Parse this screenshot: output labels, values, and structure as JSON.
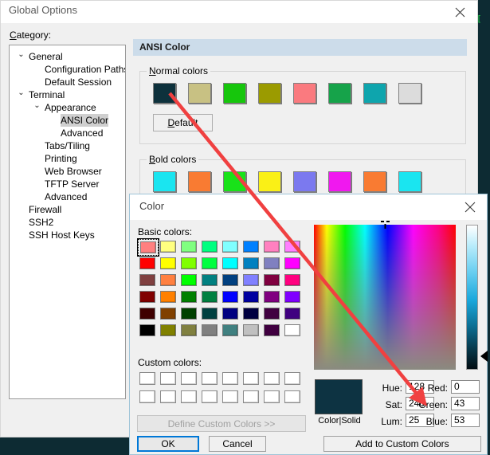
{
  "window": {
    "title": "Global Options",
    "close_icon": "close-icon",
    "category_label": "Category:"
  },
  "terminal": {
    "prompt": "["
  },
  "tree": {
    "items": [
      {
        "label": "General",
        "indent": 0,
        "chevron": "chevron-down-icon",
        "selected": false
      },
      {
        "label": "Configuration Paths",
        "indent": 1,
        "chevron": "",
        "selected": false
      },
      {
        "label": "Default Session",
        "indent": 1,
        "chevron": "",
        "selected": false
      },
      {
        "label": "Terminal",
        "indent": 0,
        "chevron": "chevron-down-icon",
        "selected": false
      },
      {
        "label": "Appearance",
        "indent": 1,
        "chevron": "chevron-down-icon",
        "selected": false
      },
      {
        "label": "ANSI Color",
        "indent": 2,
        "chevron": "",
        "selected": true
      },
      {
        "label": "Advanced",
        "indent": 2,
        "chevron": "",
        "selected": false
      },
      {
        "label": "Tabs/Tiling",
        "indent": 1,
        "chevron": "",
        "selected": false
      },
      {
        "label": "Printing",
        "indent": 1,
        "chevron": "",
        "selected": false
      },
      {
        "label": "Web Browser",
        "indent": 1,
        "chevron": "",
        "selected": false
      },
      {
        "label": "TFTP Server",
        "indent": 1,
        "chevron": "",
        "selected": false
      },
      {
        "label": "Advanced",
        "indent": 1,
        "chevron": "",
        "selected": false
      },
      {
        "label": "Firewall",
        "indent": 0,
        "chevron": "",
        "selected": false
      },
      {
        "label": "SSH2",
        "indent": 0,
        "chevron": "",
        "selected": false
      },
      {
        "label": "SSH Host Keys",
        "indent": 0,
        "chevron": "",
        "selected": false
      }
    ]
  },
  "pane": {
    "header": "ANSI Color",
    "normal_group_title": "Normal colors",
    "bold_group_title": "Bold colors",
    "default_button": "Default",
    "normal_colors": [
      "#0d313c",
      "#c8c183",
      "#16c60c",
      "#9b9b00",
      "#fa7a7f",
      "#16a34a",
      "#0ea5ad",
      "#dcdcdc"
    ],
    "bold_colors": [
      "#1ae5f0",
      "#f97b32",
      "#19e219",
      "#faf016",
      "#7b79ef",
      "#f018ef",
      "#f97b32",
      "#1ae5f0"
    ]
  },
  "color_dialog": {
    "title": "Color",
    "close_icon": "close-icon",
    "basic_label": "Basic colors:",
    "custom_label": "Custom colors:",
    "define_button": "Define Custom Colors >>",
    "ok_button": "OK",
    "cancel_button": "Cancel",
    "add_custom_button": "Add to Custom Colors",
    "preview_label": "Color|Solid",
    "preview_color": "#0d3342",
    "selected_basic_index": 0,
    "basic_colors": [
      "#ff8080",
      "#ffff80",
      "#80ff80",
      "#00ff80",
      "#80ffff",
      "#0080ff",
      "#ff80c0",
      "#ff80ff",
      "#ff0000",
      "#ffff00",
      "#80ff00",
      "#00ff40",
      "#00ffff",
      "#0080c0",
      "#8080c0",
      "#ff00ff",
      "#804040",
      "#ff8040",
      "#00ff00",
      "#008080",
      "#004080",
      "#8080ff",
      "#800040",
      "#ff0080",
      "#800000",
      "#ff8000",
      "#008000",
      "#008040",
      "#0000ff",
      "#0000a0",
      "#800080",
      "#8000ff",
      "#400000",
      "#804000",
      "#004000",
      "#004040",
      "#000080",
      "#000040",
      "#400040",
      "#400080",
      "#000000",
      "#808000",
      "#808040",
      "#808080",
      "#408080",
      "#c0c0c0",
      "#400040",
      "#ffffff"
    ],
    "custom_colors_count": 16,
    "fields": [
      {
        "id": "hue",
        "label": "Hue:",
        "value": "128"
      },
      {
        "id": "sat",
        "label": "Sat:",
        "value": "240"
      },
      {
        "id": "lum",
        "label": "Lum:",
        "value": "25"
      },
      {
        "id": "red",
        "label": "Red:",
        "value": "0"
      },
      {
        "id": "green",
        "label": "Green:",
        "value": "43"
      },
      {
        "id": "blue",
        "label": "Blue:",
        "value": "53"
      }
    ]
  },
  "annotation": {
    "arrow_color": "#f04040"
  }
}
